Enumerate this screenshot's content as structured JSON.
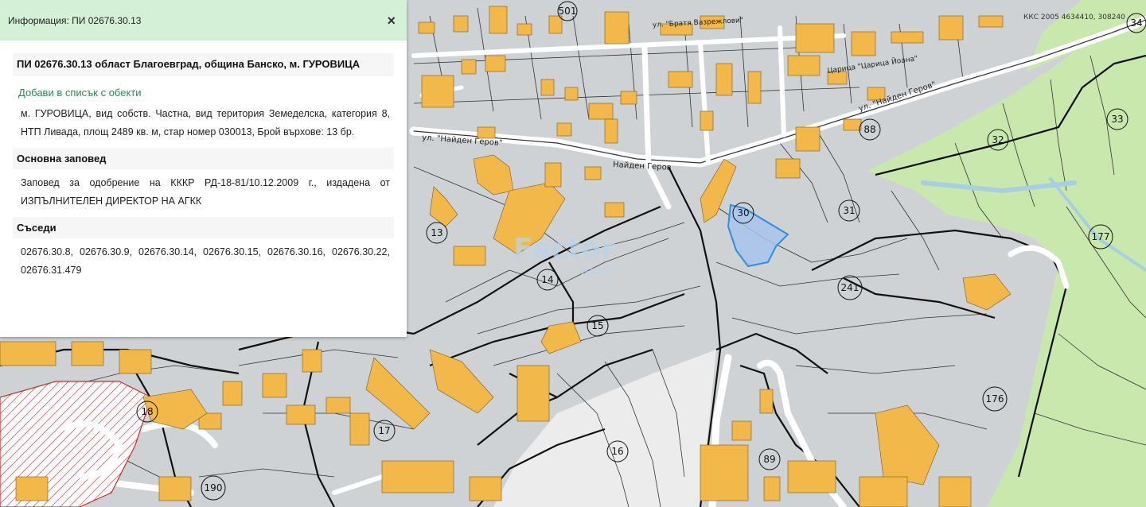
{
  "panel": {
    "header_title": "Информация: ПИ 02676.30.13",
    "close_glyph": "×",
    "heading": "ПИ 02676.30.13 област Благоевград, община Банско, м. ГУРОВИЦА",
    "add_link": "Добави в списък с обекти",
    "description": "м. ГУРОВИЦА, вид собств. Частна, вид територия Земеделска, категория 8, НТП Ливада, площ 2489 кв. м, стар номер 030013, Брой върхове: 13 бр.",
    "order_title": "Основна заповед",
    "order_text": "Заповед за одобрение на КККР РД-18-81/10.12.2009 г., издадена от ИЗПЪЛНИТЕЛЕН ДИРЕКТОР НА АГКК",
    "neighbors_title": "Съседи",
    "neighbors": "02676.30.8, 02676.30.9, 02676.30.14, 02676.30.15, 02676.30.16, 02676.30.22, 02676.31.479"
  },
  "map": {
    "colors": {
      "background": "#cfd2d4",
      "building": "#f2b84a",
      "forest": "#c8e8ae",
      "road": "#ffffff",
      "selected_parcel": "#a9c4ee",
      "selected_outline": "#2f8fdc",
      "hatch": "#d04040"
    },
    "numbers": {
      "n501": "501",
      "n34": "34",
      "n88": "88",
      "n33": "33",
      "n32": "32",
      "n30": "30",
      "n31": "31",
      "n177": "177",
      "n13": "13",
      "n14": "14",
      "n15": "15",
      "n241": "241",
      "n176": "176",
      "n18": "18",
      "n17": "17",
      "n16": "16",
      "n89": "89",
      "n190": "190"
    },
    "street_labels": {
      "s1": "ул. \"Найден Геров\"",
      "s2": "ул. \"Найден Геров\"",
      "s3": "Найден Геров",
      "s4": "ул. \"Братя Вазрежлови\"",
      "s5": "Царица \"Царица Йоана\""
    },
    "watermark": "Factor",
    "watermark_sub": "Bansko",
    "coords_label": "ККС 2005  4634410, 308240"
  }
}
